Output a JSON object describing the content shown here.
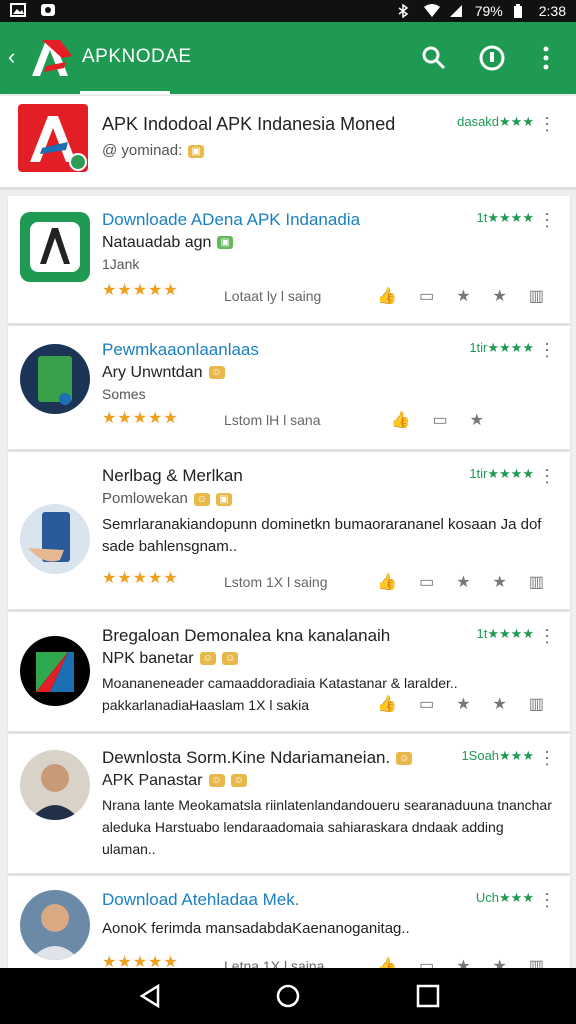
{
  "status_bar": {
    "battery": "79%",
    "time": "2:38"
  },
  "app_bar": {
    "title": "APKNODAE",
    "icons": [
      "back-icon",
      "search-icon",
      "info-icon",
      "overflow-icon"
    ],
    "accent": "#1e9a52"
  },
  "featured": {
    "name": "APK Indodoal APK Indanesia Moned",
    "sub": "@ yominad:",
    "rating": "dasakd★★★"
  },
  "cards": [
    {
      "title": "Downloade ADena APK Indanadia",
      "line2": "Natauadab agn",
      "line3": "1Jank",
      "rating": "1t★★★★",
      "stars": "★★★★★",
      "meta": "Lotaat  ly l saing"
    },
    {
      "title": "Pewmkaaonlaanlaas",
      "line2": "Ary Unwntdan",
      "line3": "Somes",
      "rating": "1tir★★★★",
      "stars": "★★★★★",
      "meta": "Lstom  lH l sana"
    },
    {
      "title": "Nerlbag & Merlkan",
      "line2": "Pomlowekan",
      "desc": "Semrlaranakiandopunn dominetkn bumaorarananel kosaan Ja dof sade bahlensgnam..",
      "rating": "1tir★★★★",
      "stars": "★★★★★",
      "meta": "Lstom  1X l saing"
    },
    {
      "title": "Bregaloan Demonalea kna kanalanaih",
      "line2": "NPK banetar",
      "desc": "Moananeneader camaaddoradiaia Katastanar & laralder.. pakkarlanadiaHaaslam  1X l sakia",
      "rating": "1t★★★★",
      "stars": "",
      "meta": ""
    },
    {
      "title": "Dewnlosta Sorm.Kine Ndariamaneian.",
      "line2": "APK Panastar",
      "desc": "Nrana lante Meokamatsla riinlatenlandandoueru searanaduuna tnanchar aleduka Harstuabo lendaraadomaia sahiaraskara dndaak adding ulaman..",
      "rating": "1Soah★★★",
      "stars": "",
      "meta": ""
    },
    {
      "title": "Download Atehladaa Mek.",
      "line2": "AonoK ferimda mansadabdaKaenanoganitag..",
      "rating": "Uch★★★",
      "stars": "★★★★★",
      "meta": "Letna  1X l saina"
    }
  ]
}
